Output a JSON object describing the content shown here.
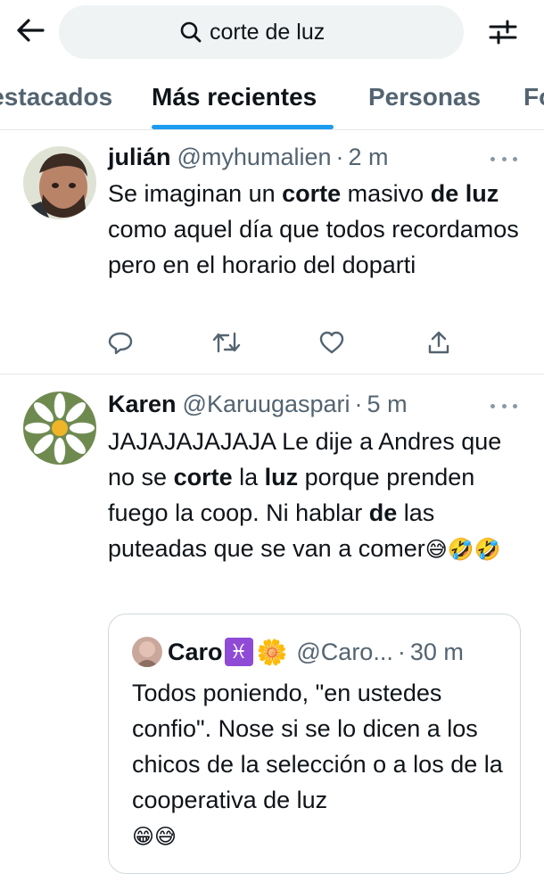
{
  "search": {
    "query": "corte de luz"
  },
  "tabs": [
    {
      "label": "Destacados"
    },
    {
      "label": "Más recientes"
    },
    {
      "label": "Personas"
    },
    {
      "label": "Fotos"
    }
  ],
  "tweets": [
    {
      "name": "julián",
      "handle": "@myhumalien",
      "dot": "·",
      "time": "2 m",
      "text": [
        {
          "t": "Se imaginan un ",
          "b": false
        },
        {
          "t": "corte",
          "b": true
        },
        {
          "t": " masivo ",
          "b": false
        },
        {
          "t": "de",
          "b": true
        },
        {
          "t": " ",
          "b": false
        },
        {
          "t": "luz",
          "b": true
        },
        {
          "t": " como aquel día que todos recordamos pero en el horario del doparti",
          "b": false
        }
      ]
    },
    {
      "name": "Karen",
      "handle": "@Karuugaspari",
      "dot": "·",
      "time": "5 m",
      "text": [
        {
          "t": "JAJAJAJAJAJA Le dije a Andres que no se ",
          "b": false
        },
        {
          "t": "corte",
          "b": true
        },
        {
          "t": " la ",
          "b": false
        },
        {
          "t": "luz",
          "b": true
        },
        {
          "t": " porque prenden fuego la coop. Ni hablar ",
          "b": false
        },
        {
          "t": "de",
          "b": true
        },
        {
          "t": " las puteadas que se van a comer",
          "b": false
        },
        {
          "t": "😅🤣🤣",
          "b": false,
          "emoji": true
        }
      ],
      "quote": {
        "name": "Caro",
        "badges": [
          "♓",
          "🌼"
        ],
        "handle": "@Caro...",
        "dot": "·",
        "time": "30 m",
        "text": "Todos poniendo, \"en ustedes confio\". Nose si se lo dicen a los chicos de la selección o a los de la cooperativa de luz",
        "emoji": "😁😅"
      }
    }
  ],
  "colors": {
    "accent": "#1d9bf0",
    "muted": "#536471",
    "badge": "#8f4bd6"
  },
  "icons": {
    "back": "arrow-left-icon",
    "search": "search-icon",
    "filter": "filter-sliders-icon",
    "reply": "reply-icon",
    "retweet": "retweet-icon",
    "like": "heart-icon",
    "share": "share-icon",
    "more": "more-dots-icon"
  }
}
